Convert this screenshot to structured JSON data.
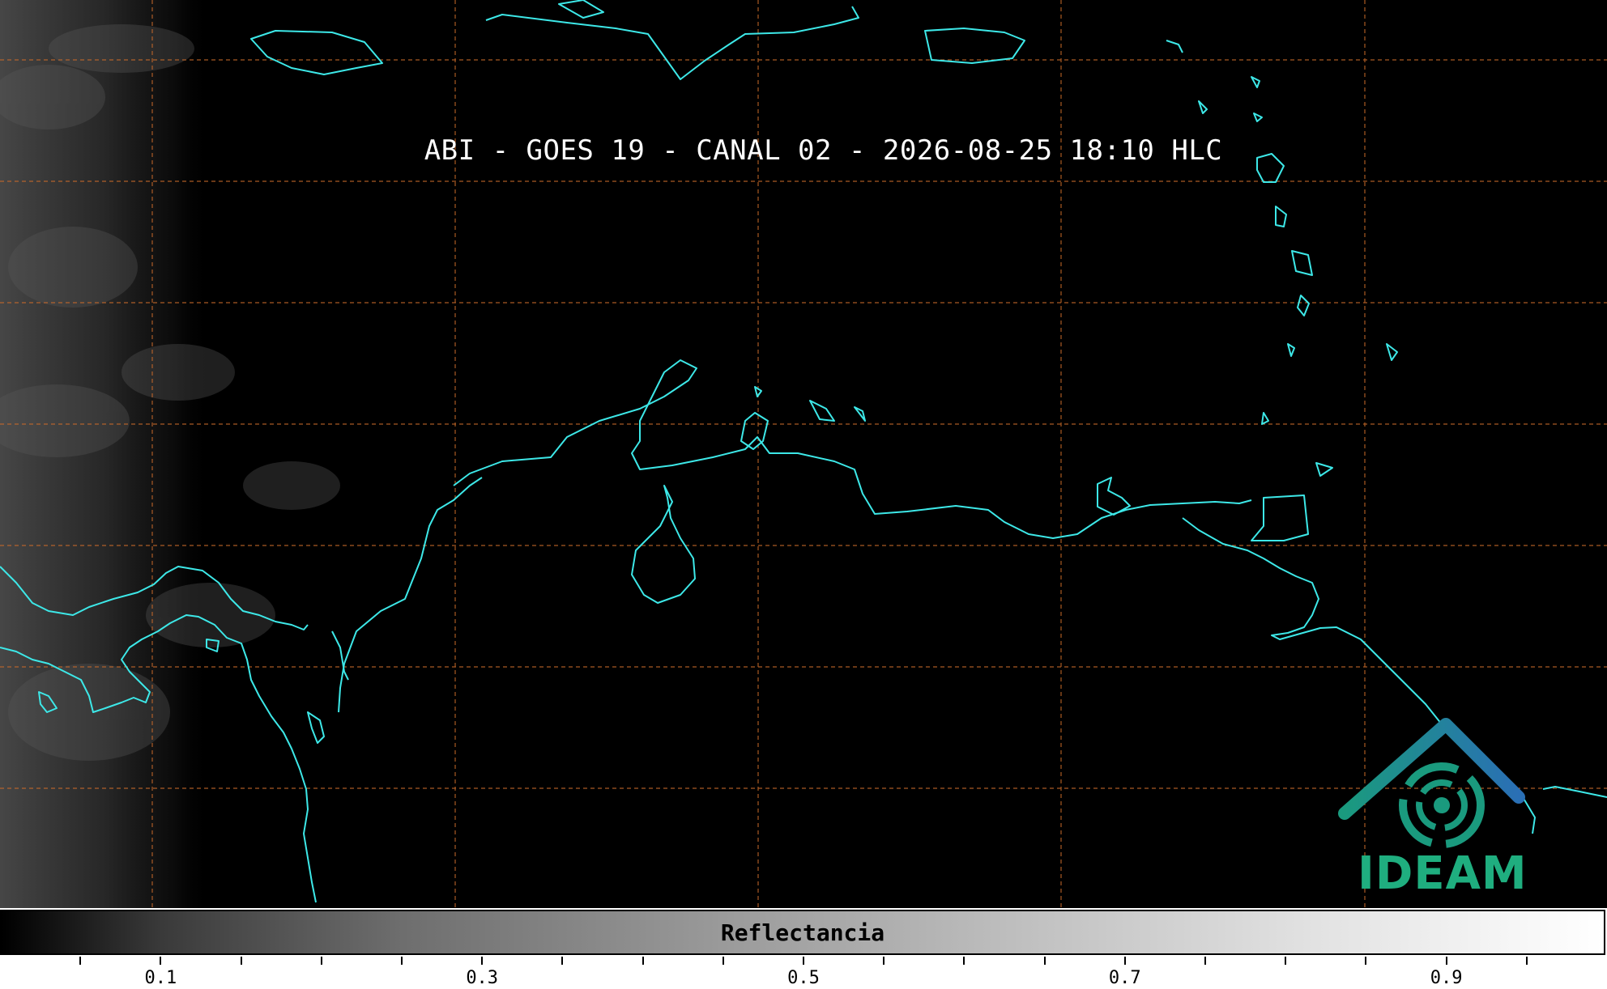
{
  "title": "ABI - GOES 19 - CANAL 02 - 2026-08-25 18:10 HLC",
  "logo": {
    "text": "IDEAM",
    "color": "#1fae7f"
  },
  "colorbar": {
    "label": "Reflectancia",
    "tick_labels": [
      "0.1",
      "0.3",
      "0.5",
      "0.7",
      "0.9"
    ]
  },
  "colors": {
    "coastline": "#3de8e8",
    "graticule": "#c86a2a",
    "background": "#000000"
  }
}
